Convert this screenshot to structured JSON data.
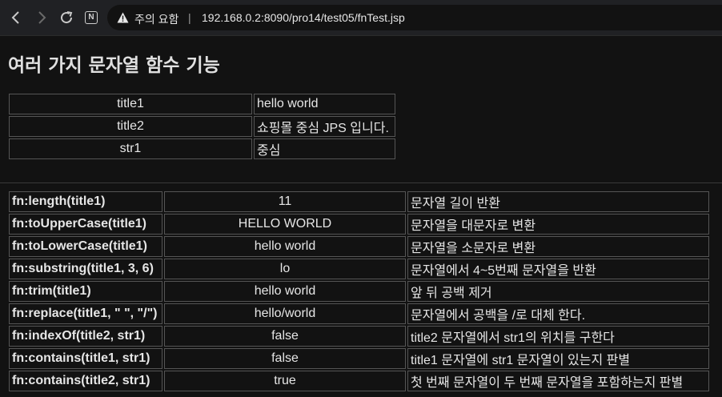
{
  "browser": {
    "back_icon": "arrow-left-icon",
    "forward_icon": "arrow-right-icon",
    "reload_icon": "reload-icon",
    "site_icon": "N",
    "security_label": "주의 요함",
    "separator": "|",
    "url": "192.168.0.2:8090/pro14/test05/fnTest.jsp"
  },
  "page": {
    "title": "여러 가지 문자열 함수 기능"
  },
  "vars_table": [
    {
      "name": "title1",
      "value": "hello world"
    },
    {
      "name": "title2",
      "value": "쇼핑몰 중심 JPS 입니다."
    },
    {
      "name": "str1",
      "value": "중심"
    }
  ],
  "functions_table": [
    {
      "expr": "fn:length(title1)",
      "result": "11",
      "desc": "문자열 길이 반환"
    },
    {
      "expr": "fn:toUpperCase(title1)",
      "result": "HELLO WORLD",
      "desc": "문자열을 대문자로 변환"
    },
    {
      "expr": "fn:toLowerCase(title1)",
      "result": "hello world",
      "desc": "문자열을 소문자로 변환"
    },
    {
      "expr": "fn:substring(title1, 3, 6)",
      "result": "lo",
      "desc": "문자열에서 4~5번째 문자열을 반환"
    },
    {
      "expr": "fn:trim(title1)",
      "result": "hello world",
      "desc": "앞 뒤 공백 제거"
    },
    {
      "expr": "fn:replace(title1, \" \", \"/\")",
      "result": "hello/world",
      "desc": "문자열에서 공백을 /로 대체 한다."
    },
    {
      "expr": "fn:indexOf(title2, str1)",
      "result": "false",
      "desc": "title2 문자열에서 str1의 위치를 구한다"
    },
    {
      "expr": "fn:contains(title1, str1)",
      "result": "false",
      "desc": "title1 문자열에 str1 문자열이 있는지 판별"
    },
    {
      "expr": "fn:contains(title2, str1)",
      "result": "true",
      "desc": "첫 번째 문자열이 두 번째 문자열을 포함하는지 판별"
    }
  ]
}
